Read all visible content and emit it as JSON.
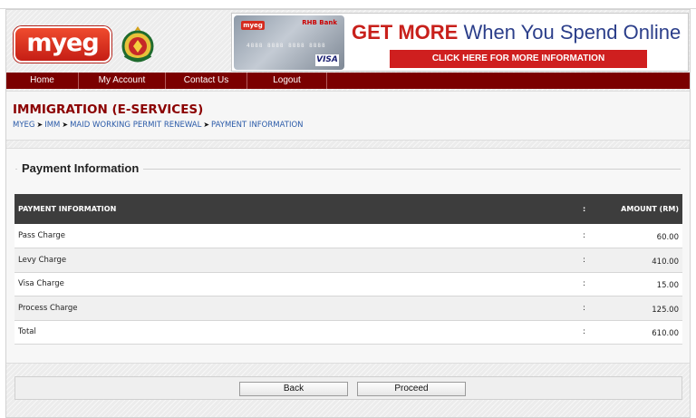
{
  "header": {
    "logo_text": "myeg",
    "banner": {
      "card_brand": "myeg",
      "card_bank": "RHB Bank",
      "card_number": "4888 8888 8888 8888",
      "card_network": "VISA",
      "headline_bold": "GET MORE",
      "headline_rest": " When You Spend Online",
      "cta_label": "CLICK HERE FOR MORE INFORMATION"
    }
  },
  "nav": {
    "items": [
      {
        "label": "Home"
      },
      {
        "label": "My Account"
      },
      {
        "label": "Contact Us"
      },
      {
        "label": "Logout"
      }
    ]
  },
  "page": {
    "title": "IMMIGRATION (E-SERVICES)",
    "breadcrumb": [
      "MYEG",
      "IMM",
      "MAID WORKING PERMIT RENEWAL",
      "PAYMENT INFORMATION"
    ],
    "breadcrumb_separator": "➤"
  },
  "payment": {
    "section_title": "Payment Information",
    "columns": {
      "item": "PAYMENT INFORMATION",
      "sep": ":",
      "amount": "AMOUNT (RM)"
    },
    "rows": [
      {
        "label": "Pass Charge",
        "sep": ":",
        "amount": "60.00"
      },
      {
        "label": "Levy Charge",
        "sep": ":",
        "amount": "410.00"
      },
      {
        "label": "Visa Charge",
        "sep": ":",
        "amount": "15.00"
      },
      {
        "label": "Process Charge",
        "sep": ":",
        "amount": "125.00"
      },
      {
        "label": "Total",
        "sep": ":",
        "amount": "610.00"
      }
    ]
  },
  "actions": {
    "back_label": "Back",
    "proceed_label": "Proceed"
  },
  "colors": {
    "nav_bg": "#7b0000",
    "title": "#8b0000",
    "link": "#2a5aa8",
    "table_header": "#3d3d3d"
  }
}
